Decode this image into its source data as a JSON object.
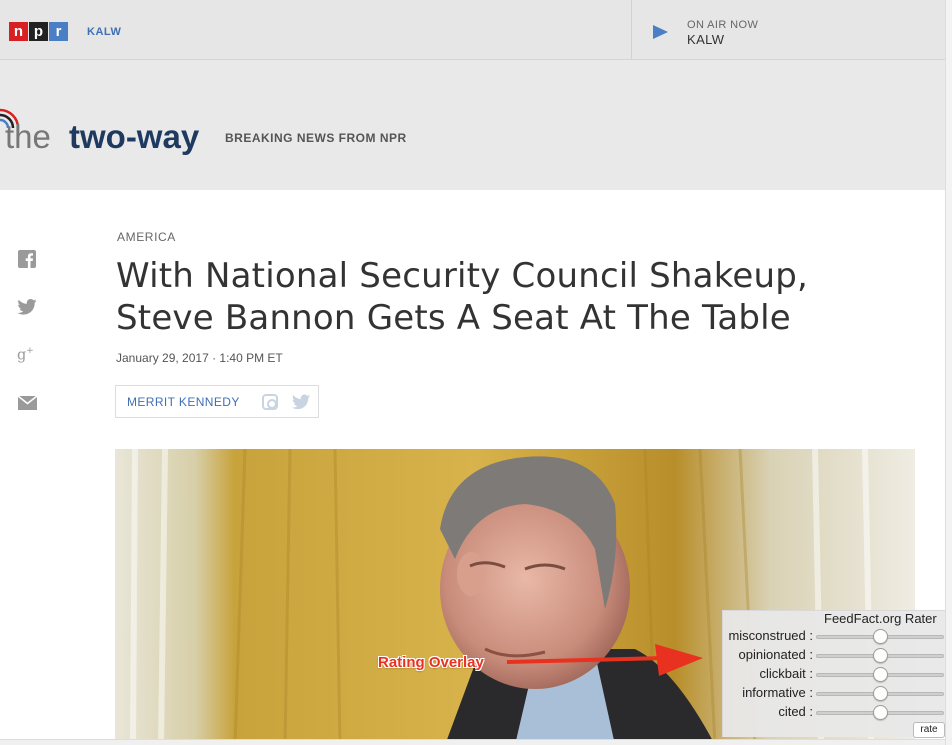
{
  "topbar": {
    "logo_letters": [
      "n",
      "p",
      "r"
    ],
    "station": "KALW",
    "on_air_label": "ON AIR NOW",
    "on_air_station": "KALW"
  },
  "blog": {
    "title_prefix": "the",
    "title_main": "two-way",
    "tagline": "BREAKING NEWS FROM NPR"
  },
  "share": [
    "facebook-icon",
    "twitter-icon",
    "google-plus-icon",
    "email-icon"
  ],
  "article": {
    "slug": "AMERICA",
    "headline": "With National Security Council Shakeup, Steve Bannon Gets A Seat At The Table",
    "date": "January 29, 2017 · 1:40 PM ET",
    "author": "MERRIT KENNEDY"
  },
  "rater": {
    "title": "FeedFact.org Rater",
    "criteria": [
      {
        "label": "misconstrued :",
        "value": 0.5
      },
      {
        "label": "opinionated :",
        "value": 0.5
      },
      {
        "label": "clickbait :",
        "value": 0.5
      },
      {
        "label": "informative :",
        "value": 0.5
      },
      {
        "label": "cited :",
        "value": 0.5
      }
    ],
    "button_label": "rate"
  },
  "annotation": {
    "label": "Rating Overlay"
  },
  "colors": {
    "npr_red": "#d62021",
    "npr_black": "#222222",
    "npr_blue": "#4a7ec5",
    "blog_navy": "#1f3a60",
    "link_blue": "#3f6fb5",
    "annotation_red": "#e8321f"
  }
}
